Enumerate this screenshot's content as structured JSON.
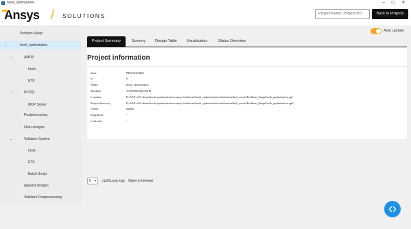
{
  "window": {
    "title": "hook_optimization"
  },
  "header": {
    "logo_text": "Ansys",
    "logo_slash": "/",
    "logo_solutions": "SOLUTIONS",
    "project_name_placeholder": "Project Name: Project-001",
    "back_label": "Back to Projects"
  },
  "sidebar": {
    "items": [
      {
        "label": "Problem Setup",
        "chevron": ""
      },
      {
        "label": "hook_optimization",
        "chevron": "⌄"
      },
      {
        "label": "AMOP",
        "chevron": "⌄"
      },
      {
        "label": "hook",
        "chevron": ""
      },
      {
        "label": "ETK",
        "chevron": ""
      },
      {
        "label": "NLPQL",
        "chevron": "⌄"
      },
      {
        "label": "MOP Solver",
        "chevron": ""
      },
      {
        "label": "Postprocessing",
        "chevron": ""
      },
      {
        "label": "Filter designs",
        "chevron": ""
      },
      {
        "label": "Validator System",
        "chevron": "⌄"
      },
      {
        "label": "hook",
        "chevron": ""
      },
      {
        "label": "ETK",
        "chevron": ""
      },
      {
        "label": "Batch Script",
        "chevron": ""
      },
      {
        "label": "Append designs",
        "chevron": ""
      },
      {
        "label": "Validator Postprocessing",
        "chevron": ""
      }
    ]
  },
  "auto_update": {
    "label": "Auto update",
    "on": true
  },
  "tabs": [
    {
      "label": "Project Summary"
    },
    {
      "label": "Scenery"
    },
    {
      "label": "Design Table"
    },
    {
      "label": "Visualization"
    },
    {
      "label": "Status Overview"
    }
  ],
  "panel": {
    "title": "Project information",
    "rows": [
      {
        "key": "State",
        "value": "PROCESSING"
      },
      {
        "key": "Id",
        "value": "0"
      },
      {
        "key": "Name",
        "value": "hook_optimization"
      },
      {
        "key": "Machine",
        "value": "AAPISHUIQUNHFI"
      },
      {
        "key": "Location",
        "value": "D:\\SAF-oSL-demo\\hook-optimization\\src\\ansys\\solutions\\hook_optimization\\solution\\method_assets\\Problem_Setup\\hook_optimization.opf"
      },
      {
        "key": "Project directory",
        "value": "D:\\SAF-oSL-demo\\hook-optimization\\src\\ansys\\solutions\\hook_optimization\\solution\\method_assets\\Problem_Setup\\hook_optimization.opd"
      },
      {
        "key": "Owner",
        "value": "nanhaf"
      },
      {
        "key": "Registered",
        "value": "--"
      },
      {
        "key": "Lock info",
        "value": "--"
      }
    ]
  },
  "footer": {
    "select_value": "0",
    "logs_label": "optiSLang logs",
    "open_browser": "Open in browser"
  },
  "colors": {
    "accent": "#f5a623",
    "fab": "#1e90e8",
    "selected": "#d7ecfa"
  },
  "icons": {
    "fab": "code-brackets-icon"
  }
}
